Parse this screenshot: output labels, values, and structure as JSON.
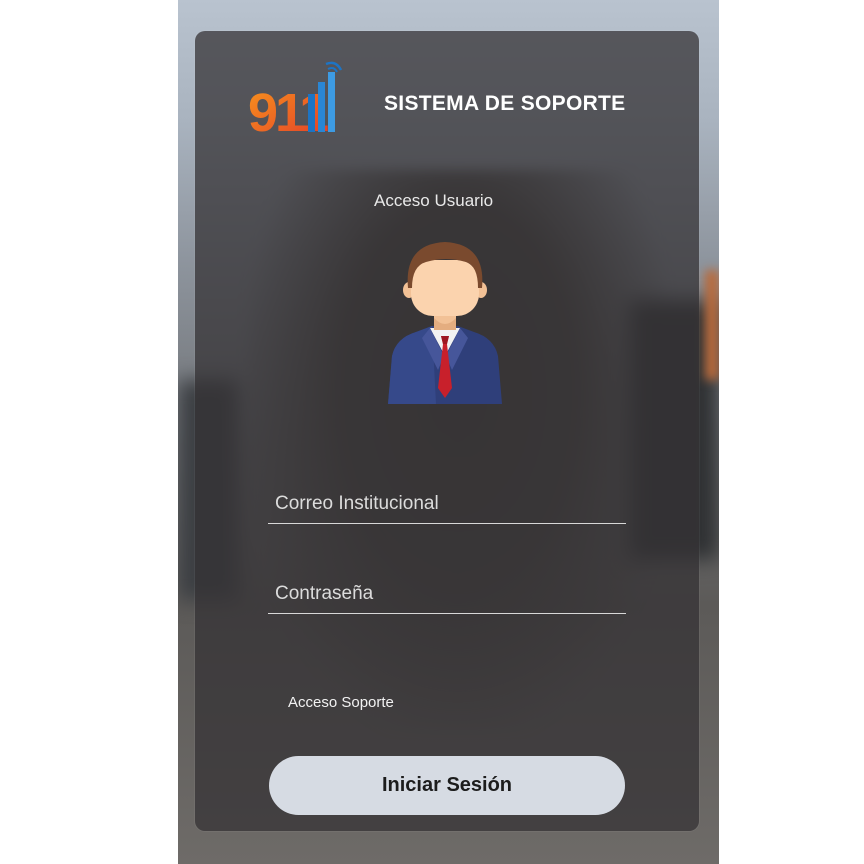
{
  "header": {
    "logo_text": "911",
    "system_title": "SISTEMA DE SOPORTE"
  },
  "login": {
    "section_title": "Acceso Usuario",
    "email_placeholder": "Correo Institucional",
    "password_placeholder": "Contraseña",
    "support_link": "Acceso Soporte",
    "submit_label": "Iniciar Sesión"
  },
  "colors": {
    "logo_orange": "#f26b21",
    "logo_red": "#e23a2a",
    "logo_blue": "#1d74c4",
    "button_bg": "#d6dbe3"
  },
  "icons": {
    "avatar": "businessman-avatar-icon",
    "logo": "911-signal-logo"
  }
}
